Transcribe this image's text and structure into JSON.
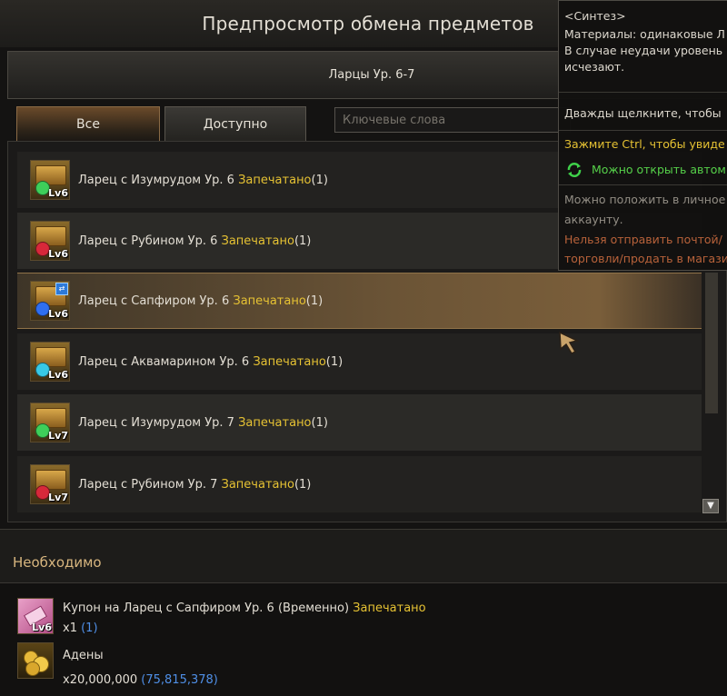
{
  "window": {
    "title": "Предпросмотр обмена предметов"
  },
  "category": {
    "label": "Ларцы Ур. 6-7"
  },
  "tabs": [
    {
      "label": "Все"
    },
    {
      "label": "Доступно"
    }
  ],
  "search": {
    "placeholder": "Ключевые слова"
  },
  "items": [
    {
      "name": "Ларец с Изумрудом Ур. 6",
      "status": "Запечатано",
      "count": "(1)",
      "level": "Lv6",
      "gem_color": "#3ecf5a",
      "icon": "emerald-chest-icon"
    },
    {
      "name": "Ларец с Рубином Ур. 6",
      "status": "Запечатано",
      "count": "(1)",
      "level": "Lv6",
      "gem_color": "#d8283a",
      "icon": "ruby-chest-icon"
    },
    {
      "name": "Ларец с Сапфиром Ур. 6",
      "status": "Запечатано",
      "count": "(1)",
      "level": "Lv6",
      "gem_color": "#2f6ff0",
      "icon": "sapphire-chest-icon",
      "selected": true
    },
    {
      "name": "Ларец с Аквамарином Ур. 6",
      "status": "Запечатано",
      "count": "(1)",
      "level": "Lv6",
      "gem_color": "#38c9e6",
      "icon": "aquamarine-chest-icon"
    },
    {
      "name": "Ларец с Изумрудом Ур. 7",
      "status": "Запечатано",
      "count": "(1)",
      "level": "Lv7",
      "gem_color": "#3ecf5a",
      "icon": "emerald-chest-icon"
    },
    {
      "name": "Ларец с Рубином Ур. 7",
      "status": "Запечатано",
      "count": "(1)",
      "level": "Lv7",
      "gem_color": "#d8283a",
      "icon": "ruby-chest-icon"
    }
  ],
  "tooltip": {
    "synth": "<Синтез>",
    "materials": "Материалы: одинаковые Л",
    "fail": "В случае неудачи уровень",
    "vanish": "исчезают.",
    "dblclick": "Дважды щелкните, чтобы",
    "ctrl": "Зажмите Ctrl, чтобы увиде",
    "auto_open": "Можно открыть автом",
    "storage": "Можно положить в личное",
    "account": "аккаунту.",
    "no_mail": "Нельзя отправить почтой/",
    "no_trade": "торговли/продать в магази"
  },
  "required": {
    "header": "Необходимо",
    "items": [
      {
        "name": "Купон на Ларец с Сапфиром Ур. 6 (Временно)",
        "status": "Запечатано",
        "qty": "x1",
        "have": "(1)",
        "level": "Lv6",
        "icon": "coupon-icon"
      },
      {
        "name": "Адены",
        "qty": "x20,000,000",
        "have": "(75,815,378)",
        "icon": "adena-icon"
      }
    ]
  },
  "colors": {
    "sealed": "#e6c233",
    "owned": "#4f8fe6",
    "accent": "#d8b67f"
  }
}
